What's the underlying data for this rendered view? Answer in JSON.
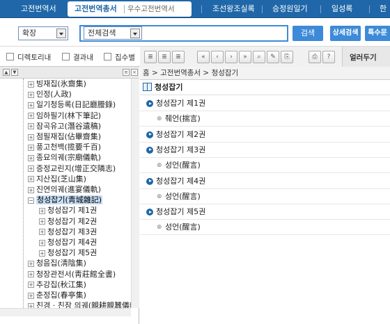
{
  "nav": {
    "items": [
      "고전번역서",
      "고전번역총서",
      "우수고전번역서",
      "조선왕조실록",
      "승정원일기",
      "일성록",
      "한"
    ],
    "active": "고전번역총서"
  },
  "search": {
    "scope_value": "확장",
    "category_value": "전체검색",
    "query_value": "",
    "search_label": "검색",
    "advanced_label": "상세검색",
    "special_label": "특수문"
  },
  "toolbar": {
    "check1": "디렉토리내",
    "check2": "결과내",
    "check3": "집수별",
    "tool_buttons": [
      "≣",
      "≣",
      "≣",
      "«",
      "‹",
      "›",
      "»",
      "⌕",
      "✎",
      "⎘",
      "⎙",
      "?"
    ],
    "right_label": "얼러두기"
  },
  "tree": {
    "items": [
      {
        "label": "빙재집(氷齋集)",
        "level": 0
      },
      {
        "label": "인정(人政)",
        "level": 0
      },
      {
        "label": "일기청등록(日記廳謄錄)",
        "level": 0
      },
      {
        "label": "임하필기(林下筆記)",
        "level": 0
      },
      {
        "label": "잠곡유고(潛谷遺稿)",
        "level": 0
      },
      {
        "label": "점필재집(佔畢齋集)",
        "level": 0
      },
      {
        "label": "풍고천백(揽要千百)",
        "level": 0
      },
      {
        "label": "종묘의궤(宗廟儀軌)",
        "level": 0
      },
      {
        "label": "증정교린지(增正交隣志)",
        "level": 0
      },
      {
        "label": "지산집(芝山集)",
        "level": 0
      },
      {
        "label": "진연의궤(進宴儀軌)",
        "level": 0
      },
      {
        "label": "청성잡기(靑城雜記)",
        "level": 0,
        "selected": true
      },
      {
        "label": "청성잡기 제1권",
        "level": 1
      },
      {
        "label": "청성잡기 제2권",
        "level": 1
      },
      {
        "label": "청성잡기 제3권",
        "level": 1
      },
      {
        "label": "청성잡기 제4권",
        "level": 1
      },
      {
        "label": "청성잡기 제5권",
        "level": 1
      },
      {
        "label": "청음집(淸陰集)",
        "level": 0
      },
      {
        "label": "청장관전서(靑莊館全書)",
        "level": 0
      },
      {
        "label": "추강집(秋江集)",
        "level": 0
      },
      {
        "label": "춘정집(春亭集)",
        "level": 0
      },
      {
        "label": "친경 · 친잠 의궤(親耕親蠶儀軌)",
        "level": 0
      }
    ]
  },
  "content": {
    "breadcrumb": "홈 > 고전번역총서 > 청성잡기",
    "title": "청성잡기",
    "rows": [
      {
        "text": "청성잡기 제1권",
        "type": "volume"
      },
      {
        "text": "췌언(揣言)",
        "type": "leaf"
      },
      {
        "text": "청성잡기 제2권",
        "type": "volume"
      },
      {
        "text": "청성잡기 제3권",
        "type": "volume"
      },
      {
        "text": "성언(醒言)",
        "type": "leaf"
      },
      {
        "text": "청성잡기 제4권",
        "type": "volume"
      },
      {
        "text": "성언(醒言)",
        "type": "leaf"
      },
      {
        "text": "청성잡기 제5권",
        "type": "volume"
      },
      {
        "text": "성언(醒言)",
        "type": "leaf"
      }
    ]
  }
}
